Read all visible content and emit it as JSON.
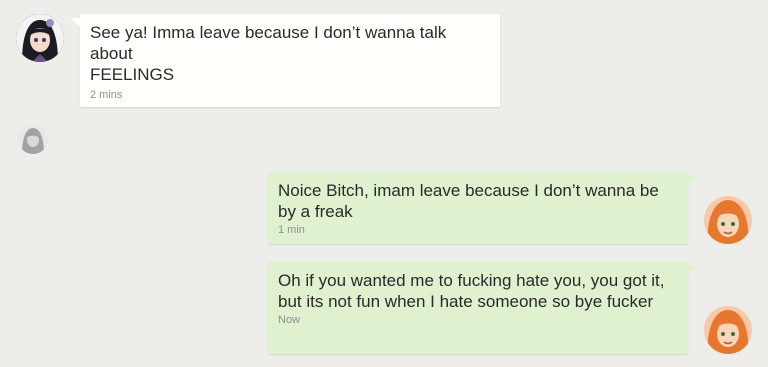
{
  "colors": {
    "background": "#ededea",
    "incoming_bubble": "#fffffb",
    "outgoing_bubble": "#e0f1cf",
    "timestamp": "#8f8f8f"
  },
  "messages": [
    {
      "sender": "incoming",
      "avatar": "girl-avatar-dark-hair",
      "text": "See ya! Imma leave because I don’t wanna talk about\nFEELINGS",
      "time": "2 mins"
    },
    {
      "sender": "incoming",
      "avatar": "girl-avatar-faded",
      "text": "",
      "time": ""
    },
    {
      "sender": "outgoing",
      "avatar": "girl-avatar-orange-hair",
      "text": "Noice Bitch, imam leave because I don’t wanna be by a freak",
      "time": "1 min"
    },
    {
      "sender": "outgoing",
      "avatar": "girl-avatar-orange-hair",
      "text": "Oh if you wanted me to fucking hate you, you got it, but its not fun when I hate someone so bye fucker",
      "time": "Now"
    }
  ]
}
